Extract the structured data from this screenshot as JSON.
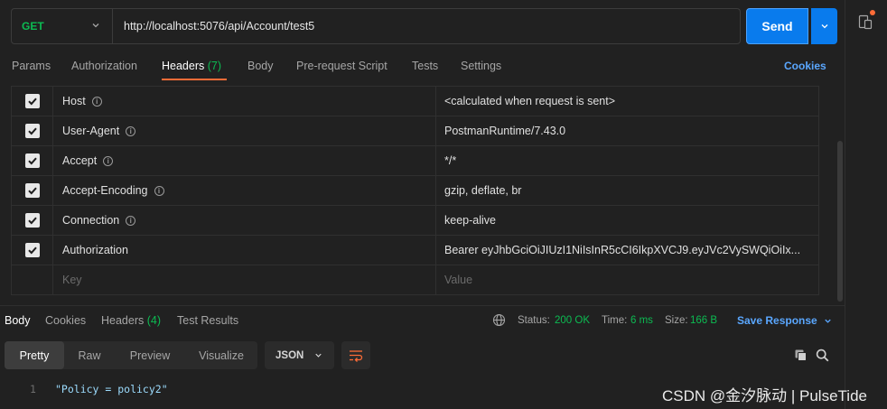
{
  "request": {
    "method": "GET",
    "url": "http://localhost:5076/api/Account/test5",
    "send_label": "Send"
  },
  "request_tabs": {
    "params": "Params",
    "authorization": "Authorization",
    "headers": "Headers",
    "headers_count": "(7)",
    "body": "Body",
    "pre_request": "Pre-request Script",
    "tests": "Tests",
    "settings": "Settings",
    "cookies": "Cookies"
  },
  "headers": [
    {
      "key": "Host",
      "value": "<calculated when request is sent>",
      "info": true
    },
    {
      "key": "User-Agent",
      "value": "PostmanRuntime/7.43.0",
      "info": true
    },
    {
      "key": "Accept",
      "value": "*/*",
      "info": true
    },
    {
      "key": "Accept-Encoding",
      "value": "gzip, deflate, br",
      "info": true
    },
    {
      "key": "Connection",
      "value": "keep-alive",
      "info": true
    },
    {
      "key": "Authorization",
      "value": "Bearer eyJhbGciOiJIUzI1NiIsInR5cCI6IkpXVCJ9.eyJVc2VySWQiOiIx...",
      "info": false
    }
  ],
  "new_header": {
    "key_placeholder": "Key",
    "value_placeholder": "Value"
  },
  "response_tabs": {
    "body": "Body",
    "cookies": "Cookies",
    "headers": "Headers",
    "headers_count": "(4)",
    "test_results": "Test Results"
  },
  "response_status": {
    "status_label": "Status:",
    "status_value": "200 OK",
    "time_label": "Time:",
    "time_value": "6 ms",
    "size_label": "Size:",
    "size_value": "166 B",
    "save_response": "Save Response"
  },
  "view_modes": [
    "Pretty",
    "Raw",
    "Preview",
    "Visualize"
  ],
  "format": "JSON",
  "response_body": [
    {
      "line": "1",
      "text": "\"Policy = policy2\""
    }
  ],
  "watermark": "CSDN @金汐脉动 | PulseTide",
  "colors": {
    "accent": "#097bed",
    "get_green": "#0cbb52",
    "tab_underline": "#ff6c37",
    "link_blue": "#5aa7ff"
  }
}
